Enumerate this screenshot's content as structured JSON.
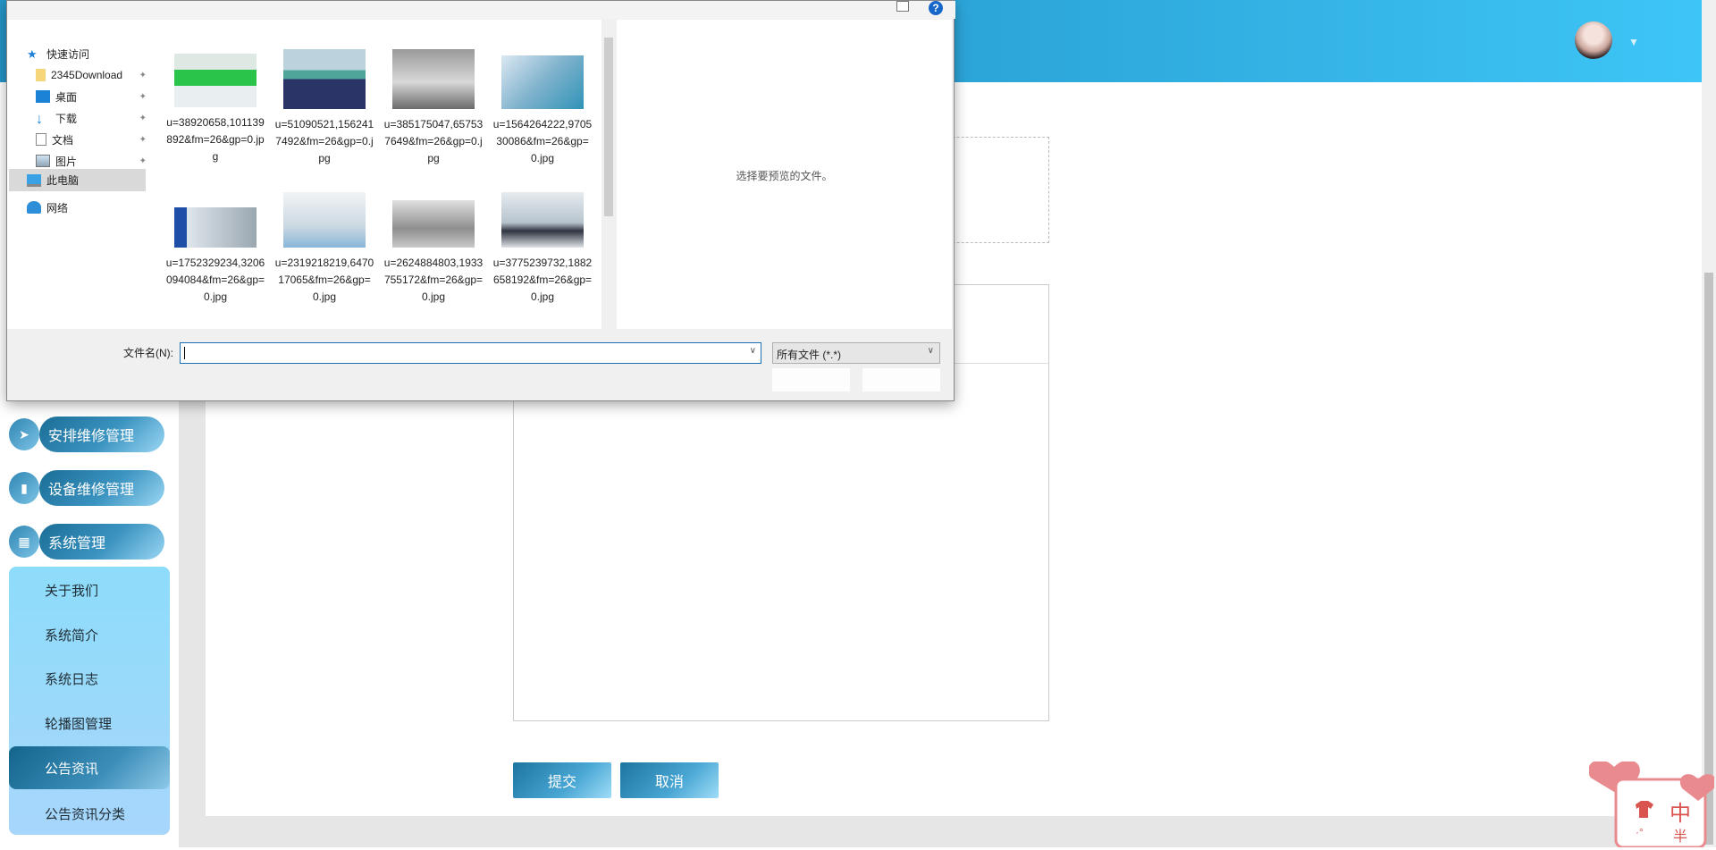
{
  "header": {
    "avatar_caret": "▼"
  },
  "sidebar": {
    "menus": [
      {
        "label": "安排维修管理",
        "icon": "send-icon"
      },
      {
        "label": "设备维修管理",
        "icon": "clipboard-icon"
      },
      {
        "label": "系统管理",
        "icon": "grid-icon"
      }
    ],
    "submenu": [
      {
        "label": "关于我们"
      },
      {
        "label": "系统简介"
      },
      {
        "label": "系统日志"
      },
      {
        "label": "轮播图管理"
      },
      {
        "label": "公告资讯",
        "active": true
      },
      {
        "label": "公告资讯分类"
      }
    ]
  },
  "form": {
    "submit_label": "提交",
    "cancel_label": "取消"
  },
  "widget": {
    "char1": "中",
    "char2": "半",
    "char3": "·°"
  },
  "dialog": {
    "help_icon": "?",
    "nav": [
      {
        "label": "快速访问",
        "icon": "star-icon"
      },
      {
        "label": "2345Download",
        "icon": "folder-icon",
        "pinned": true
      },
      {
        "label": "桌面",
        "icon": "desktop-icon",
        "pinned": true
      },
      {
        "label": "下载",
        "icon": "download-icon",
        "pinned": true
      },
      {
        "label": "文档",
        "icon": "document-icon",
        "pinned": true
      },
      {
        "label": "图片",
        "icon": "pictures-icon",
        "pinned": true
      },
      {
        "label": "此电脑",
        "icon": "computer-icon",
        "selected": true
      },
      {
        "label": "网络",
        "icon": "network-icon"
      }
    ],
    "files": [
      {
        "name": "u=38920658,101139892&fm=26&gp=0.jpg"
      },
      {
        "name": "u=51090521,1562417492&fm=26&gp=0.jpg"
      },
      {
        "name": "u=385175047,657537649&fm=26&gp=0.jpg"
      },
      {
        "name": "u=1564264222,970530086&fm=26&gp=0.jpg"
      },
      {
        "name": "u=1752329234,3206094084&fm=26&gp=0.jpg"
      },
      {
        "name": "u=2319218219,647017065&fm=26&gp=0.jpg"
      },
      {
        "name": "u=2624884803,1933755172&fm=26&gp=0.jpg"
      },
      {
        "name": "u=3775239732,1882658192&fm=26&gp=0.jpg"
      }
    ],
    "preview_text": "选择要预览的文件。",
    "filename_label": "文件名(N):",
    "filename_value": "",
    "filter_value": "所有文件 (*.*)",
    "pin_glyph": "📌"
  }
}
